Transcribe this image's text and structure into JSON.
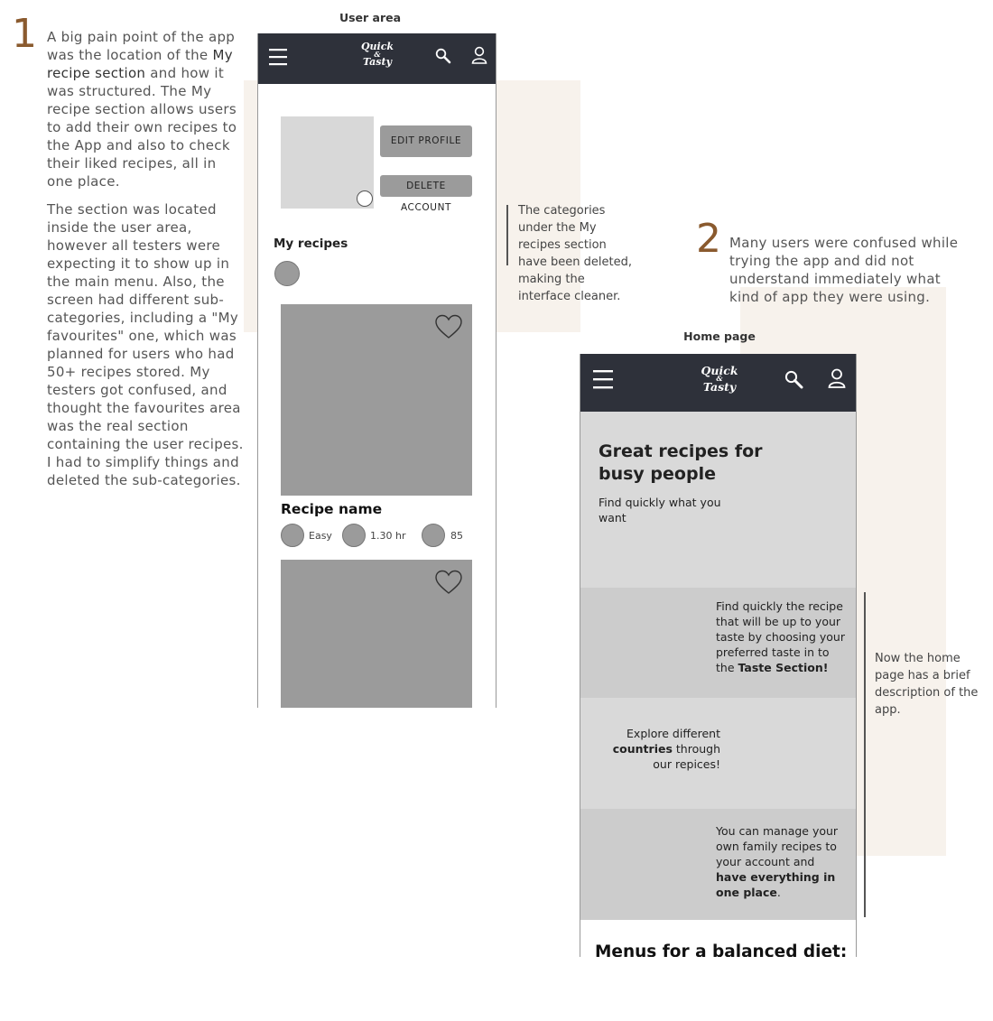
{
  "section1": {
    "number": "1",
    "para1_a": "A big pain point of the app was the location of the ",
    "para1_b": "My recipe section",
    "para1_c": " and how it was structured.  The My recipe section allows users to add their own recipes to the App and also to check their liked recipes, all in one place.",
    "para2": "The section was located inside the user area, however all testers were expecting it to show up in the main menu. Also, the screen had different sub-categories, including a \"My favourites\" one, which was planned for users who had 50+ recipes stored. My testers got confused, and thought the favourites area was the real section containing the user recipes. I had to simplify things and deleted the sub-categories."
  },
  "user_area": {
    "title": "User area",
    "logo_top": "Quick",
    "logo_amp": "&",
    "logo_bottom": "Tasty",
    "edit_profile": "EDIT PROFILE",
    "delete_account": "DELETE ACCOUNT",
    "my_recipes": "My recipes",
    "recipe_name": "Recipe name",
    "meta": [
      "Easy",
      "1.30 hr",
      "85"
    ],
    "note": "The categories under the My recipes section have been deleted, making the interface cleaner."
  },
  "section2": {
    "number": "2",
    "text": "Many users were confused while trying the app and did not understand immediately what kind of app they were using."
  },
  "home_page": {
    "title": "Home page",
    "logo_top": "Quick",
    "logo_amp": "&",
    "logo_bottom": "Tasty",
    "hero_title": "Great recipes for busy people",
    "hero_sub": "Find quickly what you want",
    "block1_a": "Find quickly the recipe that will be up to your taste by choosing your preferred taste in to the ",
    "block1_b": "Taste Section!",
    "block2_a": "Explore different ",
    "block2_b": "countries",
    "block2_c": " through our repices!",
    "block3_a": "You can manage your own family recipes to your account and ",
    "block3_b": "have everything in one place",
    "block3_c": ".",
    "menus_title": "Menus for a balanced diet:",
    "note": "Now the home page has a brief description of the app."
  },
  "colors": {
    "accent": "#8a5a2e",
    "topbar": "#2e313a",
    "placeholder": "#9b9b9b",
    "beige": "#f7f2ec"
  }
}
